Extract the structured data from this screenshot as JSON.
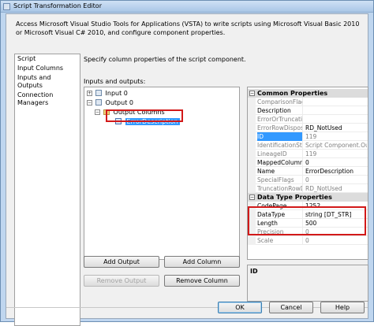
{
  "window": {
    "title": "Script Transformation Editor"
  },
  "description": "Access Microsoft Visual Studio Tools for Applications (VSTA) to write scripts using Microsoft Visual Basic 2010 or Microsoft Visual C# 2010, and configure component properties.",
  "nav": {
    "items": [
      {
        "label": "Script"
      },
      {
        "label": "Input Columns"
      },
      {
        "label": "Inputs and Outputs"
      },
      {
        "label": "Connection Managers"
      }
    ]
  },
  "main": {
    "hint": "Specify column properties of the script component.",
    "io_label": "Inputs and outputs:",
    "tree": {
      "input0": "Input 0",
      "output0": "Output 0",
      "output_columns": "Output Columns",
      "selected_column": "ErrorDescription"
    },
    "buttons": {
      "add_output": "Add Output",
      "add_column": "Add Column",
      "remove_output": "Remove Output",
      "remove_column": "Remove Column"
    }
  },
  "properties": {
    "common_header": "Common Properties",
    "common": [
      {
        "name": "ComparisonFlags",
        "value": ""
      },
      {
        "name": "Description",
        "value": ""
      },
      {
        "name": "ErrorOrTruncationAc",
        "value": ""
      },
      {
        "name": "ErrorRowDispositio",
        "value": "RD_NotUsed"
      },
      {
        "name": "ID",
        "value": "119"
      },
      {
        "name": "IdentificationString",
        "value": "Script Component.Outputs"
      },
      {
        "name": "LineageID",
        "value": "119"
      },
      {
        "name": "MappedColumnID",
        "value": "0"
      },
      {
        "name": "Name",
        "value": "ErrorDescription"
      },
      {
        "name": "SpecialFlags",
        "value": "0"
      },
      {
        "name": "TruncationRowDispo",
        "value": "RD_NotUsed"
      }
    ],
    "datatype_header": "Data Type Properties",
    "datatype": [
      {
        "name": "CodePage",
        "value": "1252"
      },
      {
        "name": "DataType",
        "value": "string [DT_STR]"
      },
      {
        "name": "Length",
        "value": "500"
      },
      {
        "name": "Precision",
        "value": "0"
      },
      {
        "name": "Scale",
        "value": "0"
      }
    ],
    "description_title": "ID"
  },
  "footer": {
    "ok": "OK",
    "cancel": "Cancel",
    "help": "Help"
  }
}
